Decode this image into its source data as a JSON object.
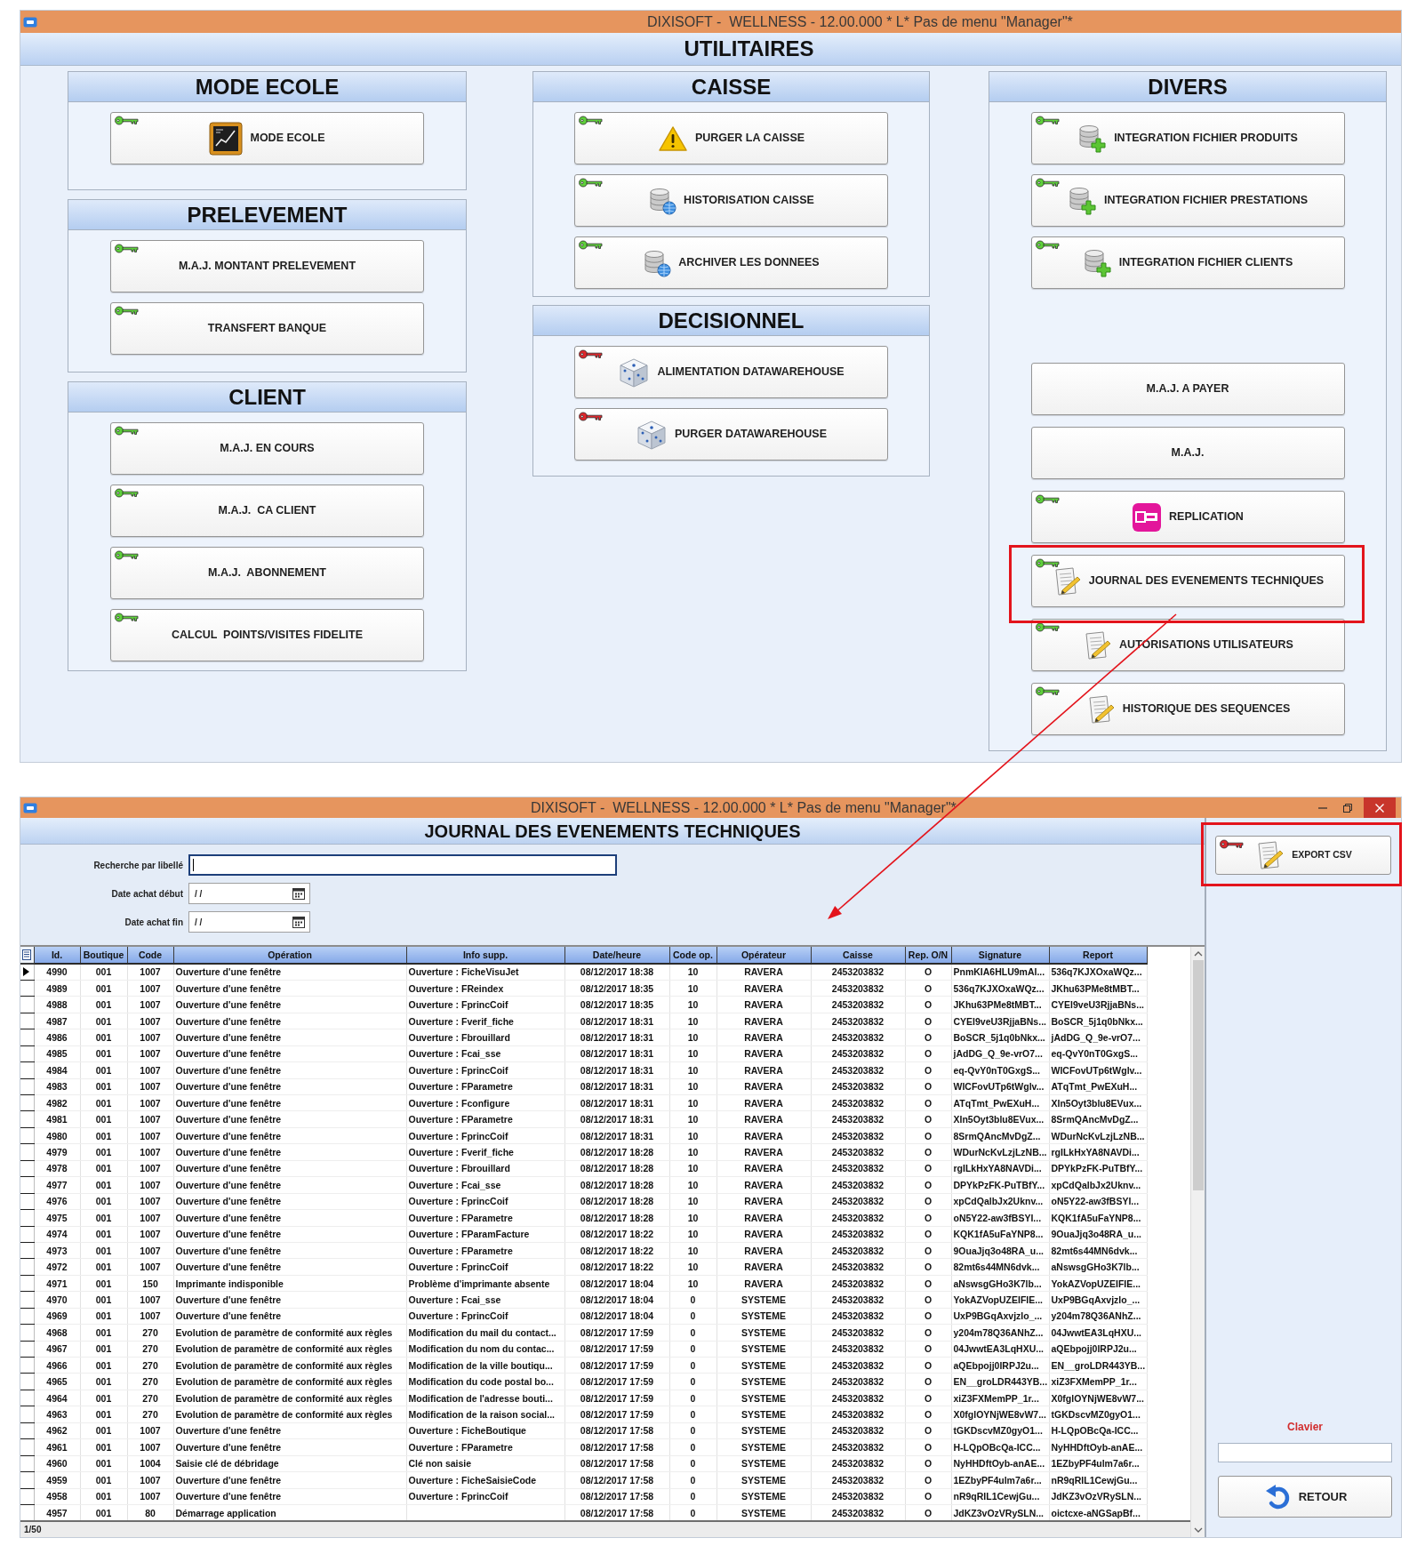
{
  "utilities_window": {
    "title": "DIXISOFT -  WELLNESS - 12.00.000 * L* Pas de menu \"Manager\"*",
    "heading": "UTILITAIRES",
    "columns": [
      {
        "groups": [
          {
            "title": "MODE ECOLE",
            "button_sets": [
              [
                {
                  "label": "MODE ECOLE",
                  "kind": "school",
                  "color": "#5ed13a",
                  "highlighted": false
                }
              ]
            ]
          },
          {
            "title": "PRELEVEMENT",
            "button_sets": [
              [
                {
                  "label": "M.A.J. MONTANT PRELEVEMENT",
                  "kind": "plain",
                  "color": "#5ed13a",
                  "highlighted": false
                },
                {
                  "label": "TRANSFERT BANQUE",
                  "kind": "plain",
                  "color": "#5ed13a",
                  "highlighted": false
                }
              ]
            ]
          },
          {
            "title": "CLIENT",
            "button_sets": [
              [
                {
                  "label": "M.A.J. EN COURS",
                  "kind": "plain",
                  "color": "#5ed13a",
                  "highlighted": false
                },
                {
                  "label": "M.A.J.  CA CLIENT",
                  "kind": "plain",
                  "color": "#5ed13a",
                  "highlighted": false
                },
                {
                  "label": "M.A.J.  ABONNEMENT",
                  "kind": "plain",
                  "color": "#5ed13a",
                  "highlighted": false
                },
                {
                  "label": "CALCUL  POINTS/VISITES FIDELITE",
                  "kind": "plain",
                  "color": "#5ed13a",
                  "highlighted": false
                }
              ]
            ]
          }
        ]
      },
      {
        "groups": [
          {
            "title": "CAISSE",
            "button_sets": [
              [
                {
                  "label": "PURGER LA CAISSE",
                  "kind": "warning",
                  "color": "#5ed13a",
                  "highlighted": false
                },
                {
                  "label": "HISTORISATION CAISSE",
                  "kind": "database",
                  "color": "#5ed13a",
                  "highlighted": false
                },
                {
                  "label": "ARCHIVER LES DONNEES",
                  "kind": "database",
                  "color": "#5ed13a",
                  "highlighted": false
                }
              ]
            ]
          },
          {
            "title": "DECISIONNEL",
            "button_sets": [
              [
                {
                  "label": "ALIMENTATION DATAWAREHOUSE",
                  "kind": "cube",
                  "color": "#e0262b",
                  "highlighted": false
                },
                {
                  "label": "PURGER DATAWAREHOUSE",
                  "kind": "cube",
                  "color": "#e0262b",
                  "highlighted": false
                }
              ]
            ]
          }
        ]
      },
      {
        "groups": [
          {
            "title": "DIVERS",
            "button_sets": [
              [
                {
                  "label": "INTEGRATION FICHIER PRODUITS",
                  "kind": "import",
                  "color": "#5ed13a",
                  "highlighted": false
                },
                {
                  "label": "INTEGRATION FICHIER PRESTATIONS",
                  "kind": "import",
                  "color": "#5ed13a",
                  "highlighted": false
                },
                {
                  "label": "INTEGRATION FICHIER CLIENTS",
                  "kind": "import",
                  "color": "#5ed13a",
                  "highlighted": false
                }
              ],
              [
                {
                  "label": "M.A.J. A PAYER",
                  "kind": "plain",
                  "highlighted": false
                },
                {
                  "label": "M.A.J.",
                  "kind": "plain",
                  "highlighted": false
                },
                {
                  "label": "REPLICATION",
                  "kind": "replication",
                  "color": "#5ed13a",
                  "highlighted": false
                },
                {
                  "label": "JOURNAL DES EVENEMENTS TECHNIQUES",
                  "kind": "document",
                  "color": "#5ed13a",
                  "highlighted": true
                },
                {
                  "label": "AUTORISATIONS UTILISATEURS",
                  "kind": "document",
                  "color": "#5ed13a",
                  "highlighted": false
                },
                {
                  "label": "HISTORIQUE DES SEQUENCES",
                  "kind": "document",
                  "color": "#5ed13a",
                  "highlighted": false
                }
              ]
            ]
          }
        ]
      }
    ]
  },
  "journal_window": {
    "title": "DIXISOFT -  WELLNESS - 12.00.000 * L* Pas de menu \"Manager\"*",
    "heading": "JOURNAL DES EVENEMENTS TECHNIQUES",
    "filters": [
      {
        "label": "Recherche par libellé",
        "kind": "text",
        "focused": true
      },
      {
        "label": "Date achat début",
        "kind": "date",
        "value": "/ /",
        "focused": false
      },
      {
        "label": "Date achat fin",
        "kind": "date",
        "value": "/ /",
        "focused": false
      }
    ],
    "table": {
      "columns": [
        {
          "label": "Id."
        },
        {
          "label": "Boutique"
        },
        {
          "label": "Code"
        },
        {
          "label": "Opération"
        },
        {
          "label": "Info supp."
        },
        {
          "label": "Date/heure"
        },
        {
          "label": "Code op."
        },
        {
          "label": "Opérateur"
        },
        {
          "label": "Caisse"
        },
        {
          "label": "Rep. O/N"
        },
        {
          "label": "Signature"
        },
        {
          "label": "Report"
        }
      ],
      "rows": [
        {
          "id": "4990",
          "shop": "001",
          "code": "1007",
          "operation": "Ouverture d'une fenêtre",
          "info": "Ouverture : FicheVisuJet",
          "datetime": "08/12/2017 18:38",
          "op_code": "10",
          "operator": "RAVERA",
          "register": "2453203832",
          "rep": "O",
          "signature": "PnmKIA6HLU9mAI...",
          "report": "536q7KJXOxaWQz...",
          "selected": true
        },
        {
          "id": "4989",
          "shop": "001",
          "code": "1007",
          "operation": "Ouverture d'une fenêtre",
          "info": "Ouverture : FReindex",
          "datetime": "08/12/2017 18:35",
          "op_code": "10",
          "operator": "RAVERA",
          "register": "2453203832",
          "rep": "O",
          "signature": "536q7KJXOxaWQz...",
          "report": "JKhu63PMe8tMBT...",
          "selected": false
        },
        {
          "id": "4988",
          "shop": "001",
          "code": "1007",
          "operation": "Ouverture d'une fenêtre",
          "info": "Ouverture : FprincCoif",
          "datetime": "08/12/2017 18:35",
          "op_code": "10",
          "operator": "RAVERA",
          "register": "2453203832",
          "rep": "O",
          "signature": "JKhu63PMe8tMBT...",
          "report": "CYEl9veU3RjjaBNs...",
          "selected": false
        },
        {
          "id": "4987",
          "shop": "001",
          "code": "1007",
          "operation": "Ouverture d'une fenêtre",
          "info": "Ouverture : Fverif_fiche",
          "datetime": "08/12/2017 18:31",
          "op_code": "10",
          "operator": "RAVERA",
          "register": "2453203832",
          "rep": "O",
          "signature": "CYEl9veU3RjjaBNs...",
          "report": "BoSCR_5j1q0bNkx...",
          "selected": false
        },
        {
          "id": "4986",
          "shop": "001",
          "code": "1007",
          "operation": "Ouverture d'une fenêtre",
          "info": "Ouverture : Fbrouillard",
          "datetime": "08/12/2017 18:31",
          "op_code": "10",
          "operator": "RAVERA",
          "register": "2453203832",
          "rep": "O",
          "signature": "BoSCR_5j1q0bNkx...",
          "report": "jAdDG_Q_9e-vrO7...",
          "selected": false
        },
        {
          "id": "4985",
          "shop": "001",
          "code": "1007",
          "operation": "Ouverture d'une fenêtre",
          "info": "Ouverture : Fcai_sse",
          "datetime": "08/12/2017 18:31",
          "op_code": "10",
          "operator": "RAVERA",
          "register": "2453203832",
          "rep": "O",
          "signature": "jAdDG_Q_9e-vrO7...",
          "report": "eq-QvY0nT0GxgS...",
          "selected": false
        },
        {
          "id": "4984",
          "shop": "001",
          "code": "1007",
          "operation": "Ouverture d'une fenêtre",
          "info": "Ouverture : FprincCoif",
          "datetime": "08/12/2017 18:31",
          "op_code": "10",
          "operator": "RAVERA",
          "register": "2453203832",
          "rep": "O",
          "signature": "eq-QvY0nT0GxgS...",
          "report": "WICFovUTp6tWglv...",
          "selected": false
        },
        {
          "id": "4983",
          "shop": "001",
          "code": "1007",
          "operation": "Ouverture d'une fenêtre",
          "info": "Ouverture : FParametre",
          "datetime": "08/12/2017 18:31",
          "op_code": "10",
          "operator": "RAVERA",
          "register": "2453203832",
          "rep": "O",
          "signature": "WICFovUTp6tWglv...",
          "report": "ATqTmt_PwEXuH...",
          "selected": false
        },
        {
          "id": "4982",
          "shop": "001",
          "code": "1007",
          "operation": "Ouverture d'une fenêtre",
          "info": "Ouverture : Fconfigure",
          "datetime": "08/12/2017 18:31",
          "op_code": "10",
          "operator": "RAVERA",
          "register": "2453203832",
          "rep": "O",
          "signature": "ATqTmt_PwEXuH...",
          "report": "XIn5Oyt3blu8EVux...",
          "selected": false
        },
        {
          "id": "4981",
          "shop": "001",
          "code": "1007",
          "operation": "Ouverture d'une fenêtre",
          "info": "Ouverture : FParametre",
          "datetime": "08/12/2017 18:31",
          "op_code": "10",
          "operator": "RAVERA",
          "register": "2453203832",
          "rep": "O",
          "signature": "XIn5Oyt3blu8EVux...",
          "report": "8SrmQAncMvDgZ...",
          "selected": false
        },
        {
          "id": "4980",
          "shop": "001",
          "code": "1007",
          "operation": "Ouverture d'une fenêtre",
          "info": "Ouverture : FprincCoif",
          "datetime": "08/12/2017 18:31",
          "op_code": "10",
          "operator": "RAVERA",
          "register": "2453203832",
          "rep": "O",
          "signature": "8SrmQAncMvDgZ...",
          "report": "WDurNcKvLzjLzNB...",
          "selected": false
        },
        {
          "id": "4979",
          "shop": "001",
          "code": "1007",
          "operation": "Ouverture d'une fenêtre",
          "info": "Ouverture : Fverif_fiche",
          "datetime": "08/12/2017 18:28",
          "op_code": "10",
          "operator": "RAVERA",
          "register": "2453203832",
          "rep": "O",
          "signature": "WDurNcKvLzjLzNB...",
          "report": "rgILkHxYA8NAVDi...",
          "selected": false
        },
        {
          "id": "4978",
          "shop": "001",
          "code": "1007",
          "operation": "Ouverture d'une fenêtre",
          "info": "Ouverture : Fbrouillard",
          "datetime": "08/12/2017 18:28",
          "op_code": "10",
          "operator": "RAVERA",
          "register": "2453203832",
          "rep": "O",
          "signature": "rgILkHxYA8NAVDi...",
          "report": "DPYkPzFK-PuTBfY...",
          "selected": false
        },
        {
          "id": "4977",
          "shop": "001",
          "code": "1007",
          "operation": "Ouverture d'une fenêtre",
          "info": "Ouverture : Fcai_sse",
          "datetime": "08/12/2017 18:28",
          "op_code": "10",
          "operator": "RAVERA",
          "register": "2453203832",
          "rep": "O",
          "signature": "DPYkPzFK-PuTBfY...",
          "report": "xpCdQalbJx2Uknv...",
          "selected": false
        },
        {
          "id": "4976",
          "shop": "001",
          "code": "1007",
          "operation": "Ouverture d'une fenêtre",
          "info": "Ouverture : FprincCoif",
          "datetime": "08/12/2017 18:28",
          "op_code": "10",
          "operator": "RAVERA",
          "register": "2453203832",
          "rep": "O",
          "signature": "xpCdQalbJx2Uknv...",
          "report": "oN5Y22-aw3fBSYI...",
          "selected": false
        },
        {
          "id": "4975",
          "shop": "001",
          "code": "1007",
          "operation": "Ouverture d'une fenêtre",
          "info": "Ouverture : FParametre",
          "datetime": "08/12/2017 18:28",
          "op_code": "10",
          "operator": "RAVERA",
          "register": "2453203832",
          "rep": "O",
          "signature": "oN5Y22-aw3fBSYI...",
          "report": "KQK1fA5uFaYNP8...",
          "selected": false
        },
        {
          "id": "4974",
          "shop": "001",
          "code": "1007",
          "operation": "Ouverture d'une fenêtre",
          "info": "Ouverture : FParamFacture",
          "datetime": "08/12/2017 18:22",
          "op_code": "10",
          "operator": "RAVERA",
          "register": "2453203832",
          "rep": "O",
          "signature": "KQK1fA5uFaYNP8...",
          "report": "9OuaJjq3o48RA_u...",
          "selected": false
        },
        {
          "id": "4973",
          "shop": "001",
          "code": "1007",
          "operation": "Ouverture d'une fenêtre",
          "info": "Ouverture : FParametre",
          "datetime": "08/12/2017 18:22",
          "op_code": "10",
          "operator": "RAVERA",
          "register": "2453203832",
          "rep": "O",
          "signature": "9OuaJjq3o48RA_u...",
          "report": "82mt6s44MN6dvk...",
          "selected": false
        },
        {
          "id": "4972",
          "shop": "001",
          "code": "1007",
          "operation": "Ouverture d'une fenêtre",
          "info": "Ouverture : FprincCoif",
          "datetime": "08/12/2017 18:22",
          "op_code": "10",
          "operator": "RAVERA",
          "register": "2453203832",
          "rep": "O",
          "signature": "82mt6s44MN6dvk...",
          "report": "aNswsgGHo3K7lb...",
          "selected": false
        },
        {
          "id": "4971",
          "shop": "001",
          "code": "150",
          "operation": "Imprimante indisponible",
          "info": "Problème d'imprimante absente",
          "datetime": "08/12/2017 18:04",
          "op_code": "10",
          "operator": "RAVERA",
          "register": "2453203832",
          "rep": "O",
          "signature": "aNswsgGHo3K7lb...",
          "report": "YokAZVopUZEIFIE...",
          "selected": false
        },
        {
          "id": "4970",
          "shop": "001",
          "code": "1007",
          "operation": "Ouverture d'une fenêtre",
          "info": "Ouverture : Fcai_sse",
          "datetime": "08/12/2017 18:04",
          "op_code": "0",
          "operator": "SYSTEME",
          "register": "2453203832",
          "rep": "O",
          "signature": "YokAZVopUZEIFIE...",
          "report": "UxP9BGqAxvjzlo_...",
          "selected": false
        },
        {
          "id": "4969",
          "shop": "001",
          "code": "1007",
          "operation": "Ouverture d'une fenêtre",
          "info": "Ouverture : FprincCoif",
          "datetime": "08/12/2017 18:04",
          "op_code": "0",
          "operator": "SYSTEME",
          "register": "2453203832",
          "rep": "O",
          "signature": "UxP9BGqAxvjzlo_...",
          "report": "y204m78Q36ANhZ...",
          "selected": false
        },
        {
          "id": "4968",
          "shop": "001",
          "code": "270",
          "operation": "Evolution de paramètre de conformité aux règles",
          "info": "Modification du mail du contact...",
          "datetime": "08/12/2017 17:59",
          "op_code": "0",
          "operator": "SYSTEME",
          "register": "2453203832",
          "rep": "O",
          "signature": "y204m78Q36ANhZ...",
          "report": "04JwwtEA3LqHXU...",
          "selected": false
        },
        {
          "id": "4967",
          "shop": "001",
          "code": "270",
          "operation": "Evolution de paramètre de conformité aux règles",
          "info": "Modification du nom du contac...",
          "datetime": "08/12/2017 17:59",
          "op_code": "0",
          "operator": "SYSTEME",
          "register": "2453203832",
          "rep": "O",
          "signature": "04JwwtEA3LqHXU...",
          "report": "aQEbpojj0IRPJ2u...",
          "selected": false
        },
        {
          "id": "4966",
          "shop": "001",
          "code": "270",
          "operation": "Evolution de paramètre de conformité aux règles",
          "info": "Modification de la ville boutiqu...",
          "datetime": "08/12/2017 17:59",
          "op_code": "0",
          "operator": "SYSTEME",
          "register": "2453203832",
          "rep": "O",
          "signature": "aQEbpojj0IRPJ2u...",
          "report": "EN__groLDR443YB...",
          "selected": false
        },
        {
          "id": "4965",
          "shop": "001",
          "code": "270",
          "operation": "Evolution de paramètre de conformité aux règles",
          "info": "Modification du code postal bo...",
          "datetime": "08/12/2017 17:59",
          "op_code": "0",
          "operator": "SYSTEME",
          "register": "2453203832",
          "rep": "O",
          "signature": "EN__groLDR443YB...",
          "report": "xiZ3FXMemPP_1r...",
          "selected": false
        },
        {
          "id": "4964",
          "shop": "001",
          "code": "270",
          "operation": "Evolution de paramètre de conformité aux règles",
          "info": "Modification de l'adresse bouti...",
          "datetime": "08/12/2017 17:59",
          "op_code": "0",
          "operator": "SYSTEME",
          "register": "2453203832",
          "rep": "O",
          "signature": "xiZ3FXMemPP_1r...",
          "report": "X0fglOYNjWE8vW7...",
          "selected": false
        },
        {
          "id": "4963",
          "shop": "001",
          "code": "270",
          "operation": "Evolution de paramètre de conformité aux règles",
          "info": "Modification de la raison social...",
          "datetime": "08/12/2017 17:59",
          "op_code": "0",
          "operator": "SYSTEME",
          "register": "2453203832",
          "rep": "O",
          "signature": "X0fglOYNjWE8vW7...",
          "report": "tGKDscvMZ0gyO1...",
          "selected": false
        },
        {
          "id": "4962",
          "shop": "001",
          "code": "1007",
          "operation": "Ouverture d'une fenêtre",
          "info": "Ouverture : FicheBoutique",
          "datetime": "08/12/2017 17:58",
          "op_code": "0",
          "operator": "SYSTEME",
          "register": "2453203832",
          "rep": "O",
          "signature": "tGKDscvMZ0gyO1...",
          "report": "H-LQpOBcQa-ICC...",
          "selected": false
        },
        {
          "id": "4961",
          "shop": "001",
          "code": "1007",
          "operation": "Ouverture d'une fenêtre",
          "info": "Ouverture : FParametre",
          "datetime": "08/12/2017 17:58",
          "op_code": "0",
          "operator": "SYSTEME",
          "register": "2453203832",
          "rep": "O",
          "signature": "H-LQpOBcQa-ICC...",
          "report": "NyHHDftOyb-anAE...",
          "selected": false
        },
        {
          "id": "4960",
          "shop": "001",
          "code": "1004",
          "operation": "Saisie clé de débridage",
          "info": "Clé non saisie",
          "datetime": "08/12/2017 17:58",
          "op_code": "0",
          "operator": "SYSTEME",
          "register": "2453203832",
          "rep": "O",
          "signature": "NyHHDftOyb-anAE...",
          "report": "1EZbyPF4ulm7a6r...",
          "selected": false
        },
        {
          "id": "4959",
          "shop": "001",
          "code": "1007",
          "operation": "Ouverture d'une fenêtre",
          "info": "Ouverture : FicheSaisieCode",
          "datetime": "08/12/2017 17:58",
          "op_code": "0",
          "operator": "SYSTEME",
          "register": "2453203832",
          "rep": "O",
          "signature": "1EZbyPF4ulm7a6r...",
          "report": "nR9qRIL1CewjGu...",
          "selected": false
        },
        {
          "id": "4958",
          "shop": "001",
          "code": "1007",
          "operation": "Ouverture d'une fenêtre",
          "info": "Ouverture : FprincCoif",
          "datetime": "08/12/2017 17:58",
          "op_code": "0",
          "operator": "SYSTEME",
          "register": "2453203832",
          "rep": "O",
          "signature": "nR9qRIL1CewjGu...",
          "report": "JdKZ3vOzVRySLN...",
          "selected": false
        },
        {
          "id": "4957",
          "shop": "001",
          "code": "80",
          "operation": "Démarrage application",
          "datetime": "08/12/2017 17:58",
          "op_code": "0",
          "operator": "SYSTEME",
          "register": "2453203832",
          "rep": "O",
          "signature": "JdKZ3vOzVRySLN...",
          "report": "oictcxe-aNGSapBf...",
          "selected": false
        }
      ],
      "status": "1/50"
    },
    "side_panel": {
      "export_button": {
        "label": "EXPORT CSV",
        "color": "#e0262b",
        "highlighted": true
      },
      "keyboard_field": {
        "label": "Clavier"
      },
      "return_button": {
        "label": "RETOUR"
      }
    }
  }
}
